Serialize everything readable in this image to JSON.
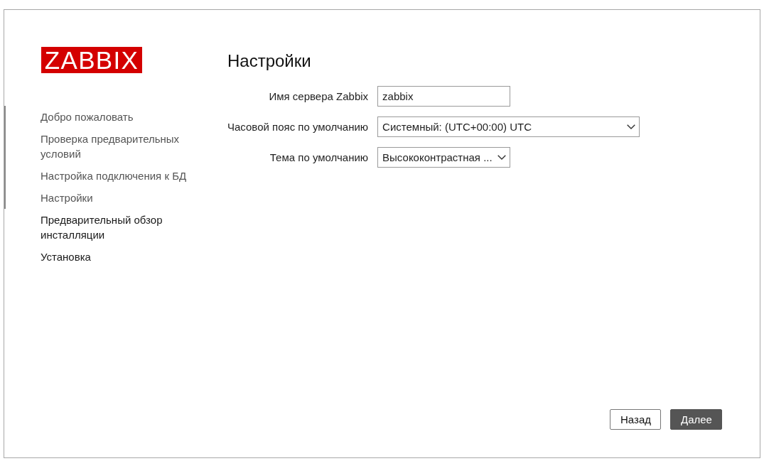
{
  "logo": {
    "text": "ZABBIX"
  },
  "steps": [
    {
      "label": "Добро пожаловать",
      "done": true
    },
    {
      "label": "Проверка предварительных условий",
      "done": true
    },
    {
      "label": "Настройка подключения к БД",
      "done": true
    },
    {
      "label": "Настройки",
      "done": true
    },
    {
      "label": "Предварительный обзор инсталляции",
      "done": false
    },
    {
      "label": "Установка",
      "done": false
    }
  ],
  "page_title": "Настройки",
  "form": {
    "fields": [
      {
        "kind": "text",
        "label": "Имя сервера Zabbix",
        "value": "zabbix"
      },
      {
        "kind": "select",
        "label": "Часовой пояс по умолчанию",
        "value": "Системный: (UTC+00:00) UTC"
      },
      {
        "kind": "select",
        "label": "Тема по умолчанию",
        "value": "Высококонтрастная ..."
      }
    ]
  },
  "buttons": [
    {
      "label": "Назад",
      "kind": "secondary"
    },
    {
      "label": "Далее",
      "kind": "primary"
    }
  ]
}
